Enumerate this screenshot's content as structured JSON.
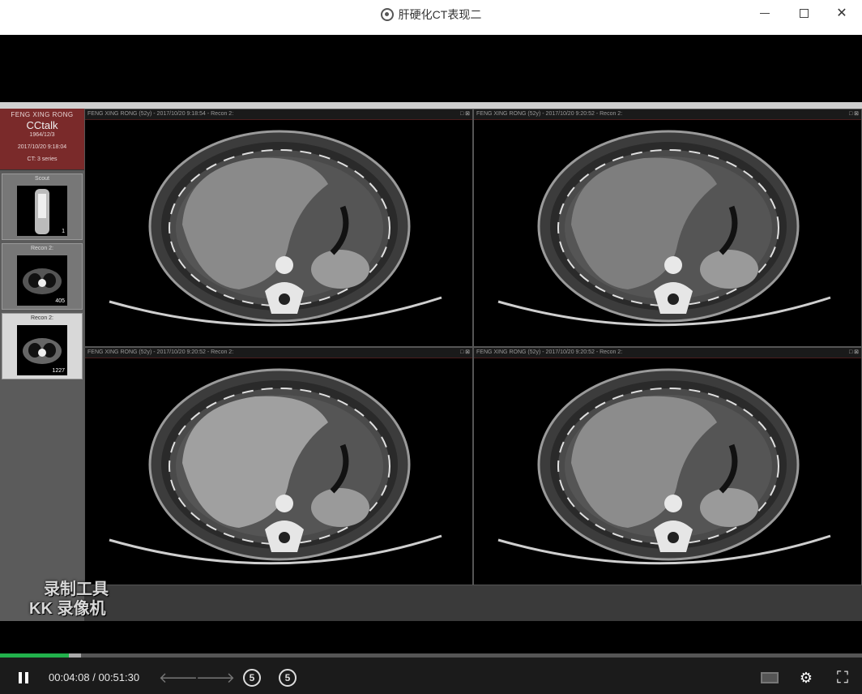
{
  "window": {
    "title": "肝硬化CT表现二",
    "minimize_icon": "minimize-icon",
    "maximize_icon": "maximize-icon",
    "close_icon": "close-icon"
  },
  "sidebar": {
    "patient_name": "FENG XING RONG",
    "brand": "CCtalk",
    "birth_date": "1964/12/3",
    "study_datetime": "2017/10/20 9:18:04",
    "study_info": "CT: 3 series",
    "series": [
      {
        "label": "Scout",
        "count": "1"
      },
      {
        "label": "Recon 2:",
        "count": "405"
      },
      {
        "label": "Recon 2:",
        "count": "1227"
      }
    ]
  },
  "panes": [
    {
      "header": "FENG XING RONG  (52y) - 2017/10/20 9:18:54 - Recon 2:"
    },
    {
      "header": "FENG XING RONG  (52y) - 2017/10/20 9:20:52 - Recon 2:"
    },
    {
      "header": "FENG XING RONG  (52y) - 2017/10/20 9:20:52 - Recon 2:"
    },
    {
      "header": "FENG XING RONG  (52y) - 2017/10/20 9:20:52 - Recon 2:"
    }
  ],
  "watermark": {
    "line1": "录制工具",
    "line2": "KK 录像机"
  },
  "player": {
    "current_time": "00:04:08",
    "separator": "/",
    "total_time": "00:51:30",
    "progress_played": 0.08,
    "progress_buffered": 0.094,
    "rewind_label": "5",
    "forward_label": "5",
    "accent_color": "#22b14c"
  }
}
